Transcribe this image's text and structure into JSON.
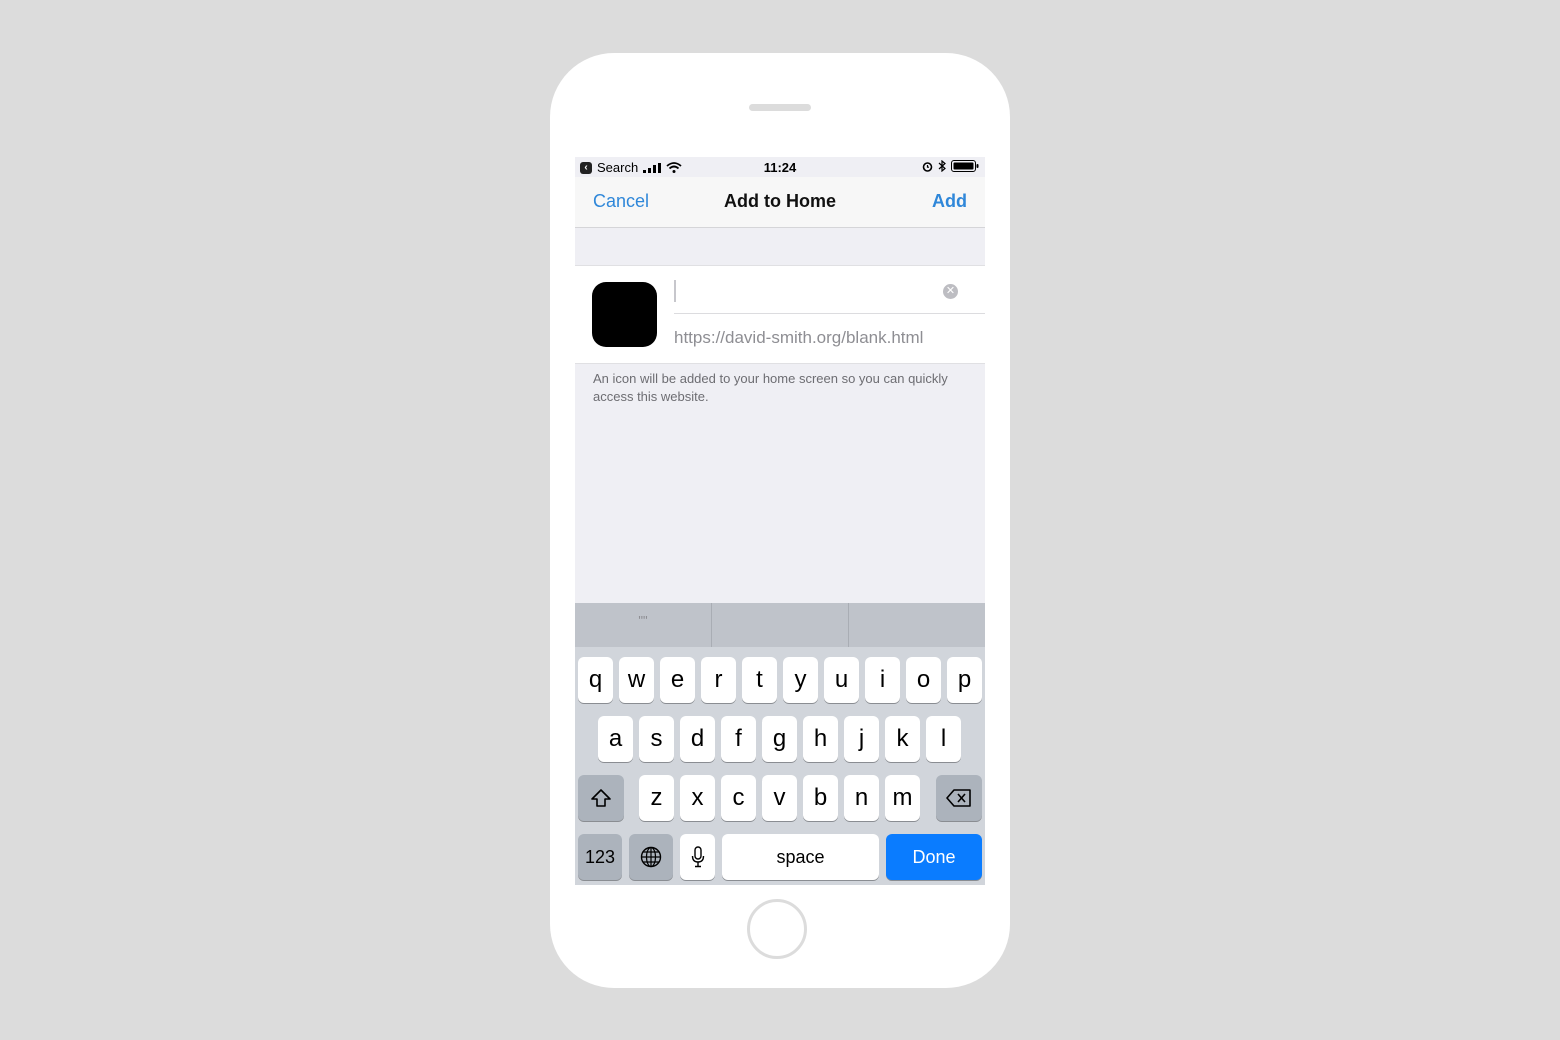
{
  "status_bar": {
    "back_app": "Search",
    "time": "11:24"
  },
  "nav": {
    "cancel": "Cancel",
    "title": "Add to Home",
    "add": "Add"
  },
  "form": {
    "name_value": "",
    "url": "https://david-smith.org/blank.html"
  },
  "footer_text": "An icon will be added to your home screen so you can quickly access this website.",
  "keyboard": {
    "suggestions": [
      "\"\"",
      "",
      ""
    ],
    "row1": [
      "q",
      "w",
      "e",
      "r",
      "t",
      "y",
      "u",
      "i",
      "o",
      "p"
    ],
    "row2": [
      "a",
      "s",
      "d",
      "f",
      "g",
      "h",
      "j",
      "k",
      "l"
    ],
    "row3": [
      "z",
      "x",
      "c",
      "v",
      "b",
      "n",
      "m"
    ],
    "numbers_key": "123",
    "space_key": "space",
    "done_key": "Done"
  },
  "colors": {
    "accent": "#2f87d9",
    "done": "#0a7cff"
  }
}
